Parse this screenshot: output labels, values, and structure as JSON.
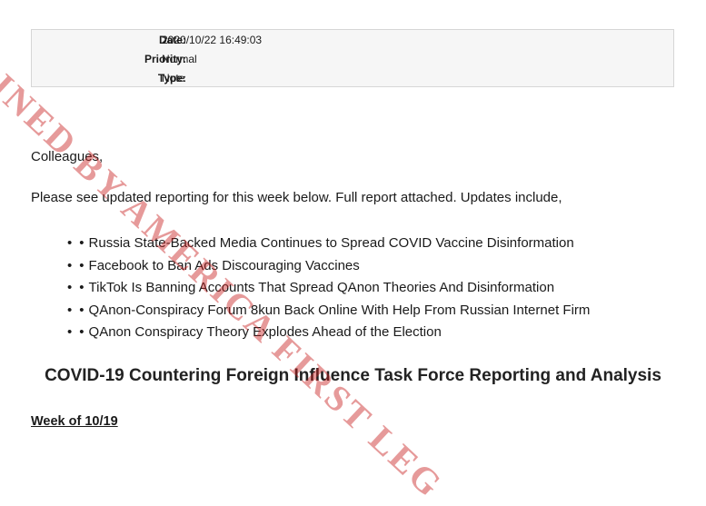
{
  "header": {
    "date_label": "Date:",
    "date_value": "2020/10/22 16:49:03",
    "priority_label": "Priority:",
    "priority_value": "Normal",
    "type_label": "Type:",
    "type_value": "Note"
  },
  "body": {
    "greeting": "Colleagues,",
    "intro": "Please see updated reporting for this week below. Full report attached. Updates include,",
    "bullet_glyph": "•",
    "items": [
      "Russia State-Backed Media Continues to Spread COVID Vaccine Disinformation",
      "Facebook to Ban Ads Discouraging Vaccines",
      "TikTok Is Banning Accounts That Spread QAnon Theories And Disinformation",
      "QAnon-Conspiracy Forum 8kun Back Online With Help From Russian Internet Firm",
      "QAnon Conspiracy Theory Explodes Ahead of the Election"
    ],
    "heading": "COVID-19 Countering Foreign Influence Task Force Reporting and Analysis",
    "week": "Week of 10/19"
  },
  "stamp": {
    "text": "AINED BY AMERICA FIRST LEG",
    "color": "#c81e1e"
  }
}
